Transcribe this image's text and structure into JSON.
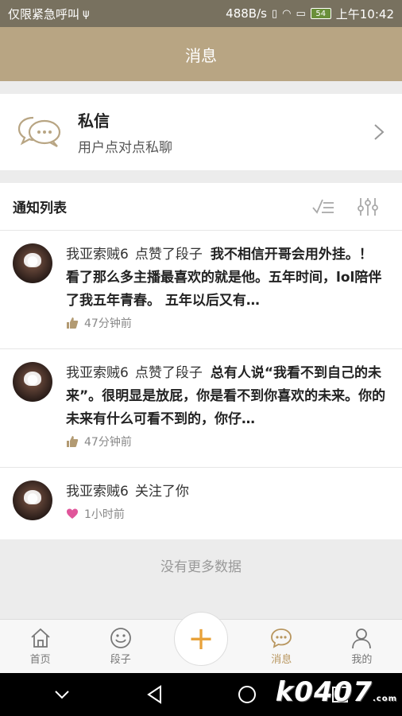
{
  "status_bar": {
    "left_text": "仅限紧急呼叫",
    "usb_glyph": "ψ",
    "speed": "488B/s",
    "battery": "54",
    "time": "上午10:42"
  },
  "header": {
    "title": "消息"
  },
  "private_message": {
    "title": "私信",
    "subtitle": "用户点对点私聊",
    "icon": "chat-bubbles-icon"
  },
  "notice": {
    "title": "通知列表",
    "icons": [
      "mark-read-icon",
      "filter-sliders-icon"
    ],
    "items": [
      {
        "user": "我亚索贼6",
        "action": "点赞了段子",
        "content": "我不相信开哥会用外挂。！ 看了那么多主播最喜欢的就是他。五年时间，lol陪伴了我五年青春。 五年以后又有…",
        "meta_icon": "thumbs-up-icon",
        "time": "47分钟前"
      },
      {
        "user": "我亚索贼6",
        "action": "点赞了段子",
        "content": "总有人说“我看不到自己的未来”。很明显是放屁，你是看不到你喜欢的未来。你的未来有什么可看不到的，你仔…",
        "meta_icon": "thumbs-up-icon",
        "time": "47分钟前"
      },
      {
        "user": "我亚索贼6",
        "action": "关注了你",
        "content": "",
        "meta_icon": "heart-icon",
        "time": "1小时前"
      }
    ]
  },
  "no_more": "没有更多数据",
  "tabbar": {
    "tabs": [
      {
        "label": "首页",
        "icon": "home-icon"
      },
      {
        "label": "段子",
        "icon": "smile-icon"
      },
      {
        "label": "+",
        "icon": "plus-icon"
      },
      {
        "label": "消息",
        "icon": "message-icon"
      },
      {
        "label": "我的",
        "icon": "profile-icon"
      }
    ],
    "active": "消息"
  },
  "watermark": {
    "text": "k0407",
    "suffix": ".com"
  },
  "colors": {
    "status_bar": "#78715f",
    "header": "#b8a583",
    "accent": "#b8965f",
    "plus": "#e8a23a",
    "heart": "#e0559a"
  }
}
